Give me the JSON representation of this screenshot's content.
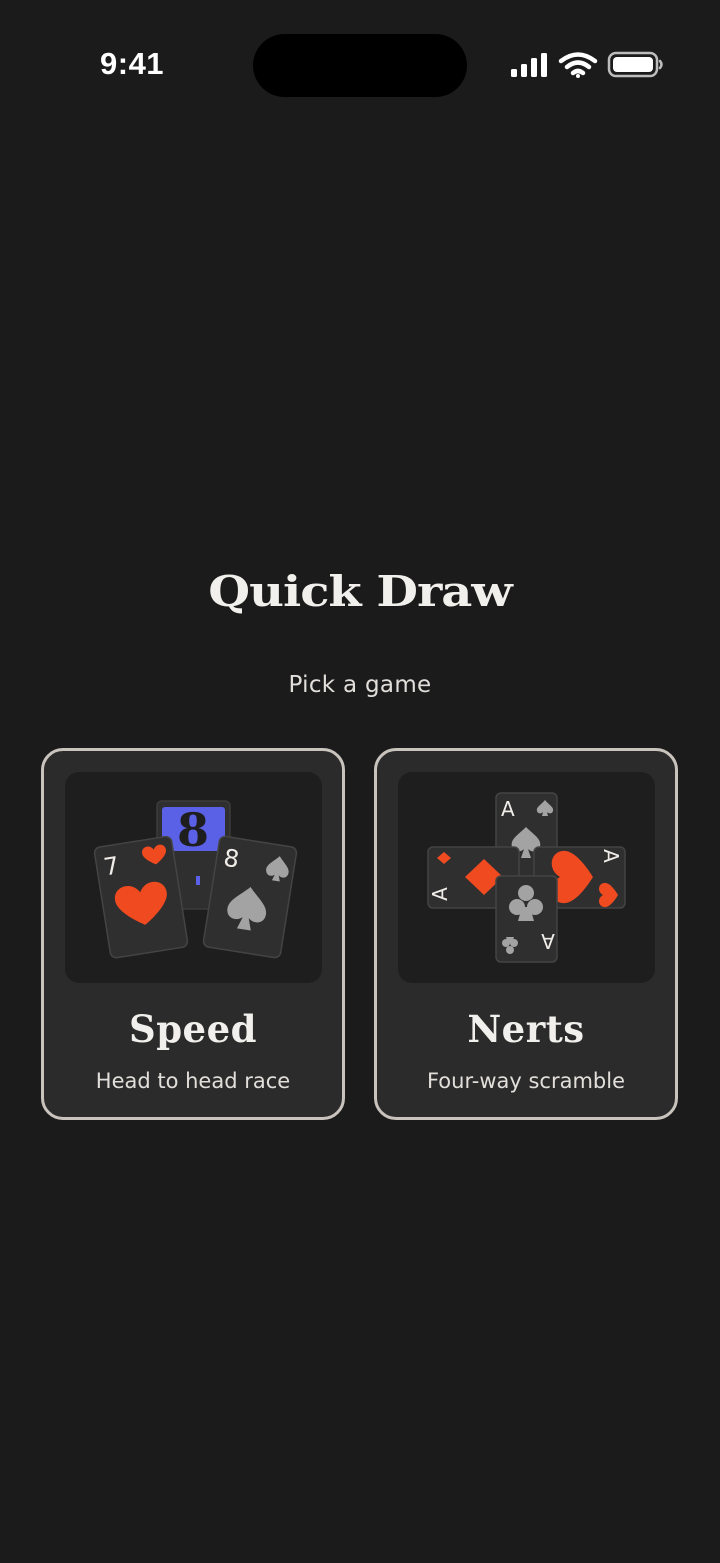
{
  "status_bar": {
    "time": "9:41",
    "icons": [
      "cellular-signal-icon",
      "wifi-icon",
      "battery-icon"
    ]
  },
  "app": {
    "title": "Quick Draw",
    "subtitle": "Pick a game"
  },
  "games": [
    {
      "name": "Speed",
      "description": "Head to head race",
      "art_cards": [
        {
          "rank": "7",
          "suit": "heart"
        },
        {
          "rank": "",
          "suit": "card-back"
        },
        {
          "rank": "8",
          "suit": "spade"
        }
      ]
    },
    {
      "name": "Nerts",
      "description": "Four-way scramble",
      "art_cards": [
        {
          "rank": "A",
          "suit": "spade"
        },
        {
          "rank": "A",
          "suit": "diamond"
        },
        {
          "rank": "A",
          "suit": "heart"
        },
        {
          "rank": "A",
          "suit": "club"
        }
      ]
    }
  ],
  "colors": {
    "background": "#1b1b1b",
    "card_surface": "#2b2b2b",
    "card_border": "#c9c3bd",
    "red_suit": "#f04a20",
    "black_suit": "#a3a3a3",
    "card_back_accent": "#5a61e6"
  }
}
